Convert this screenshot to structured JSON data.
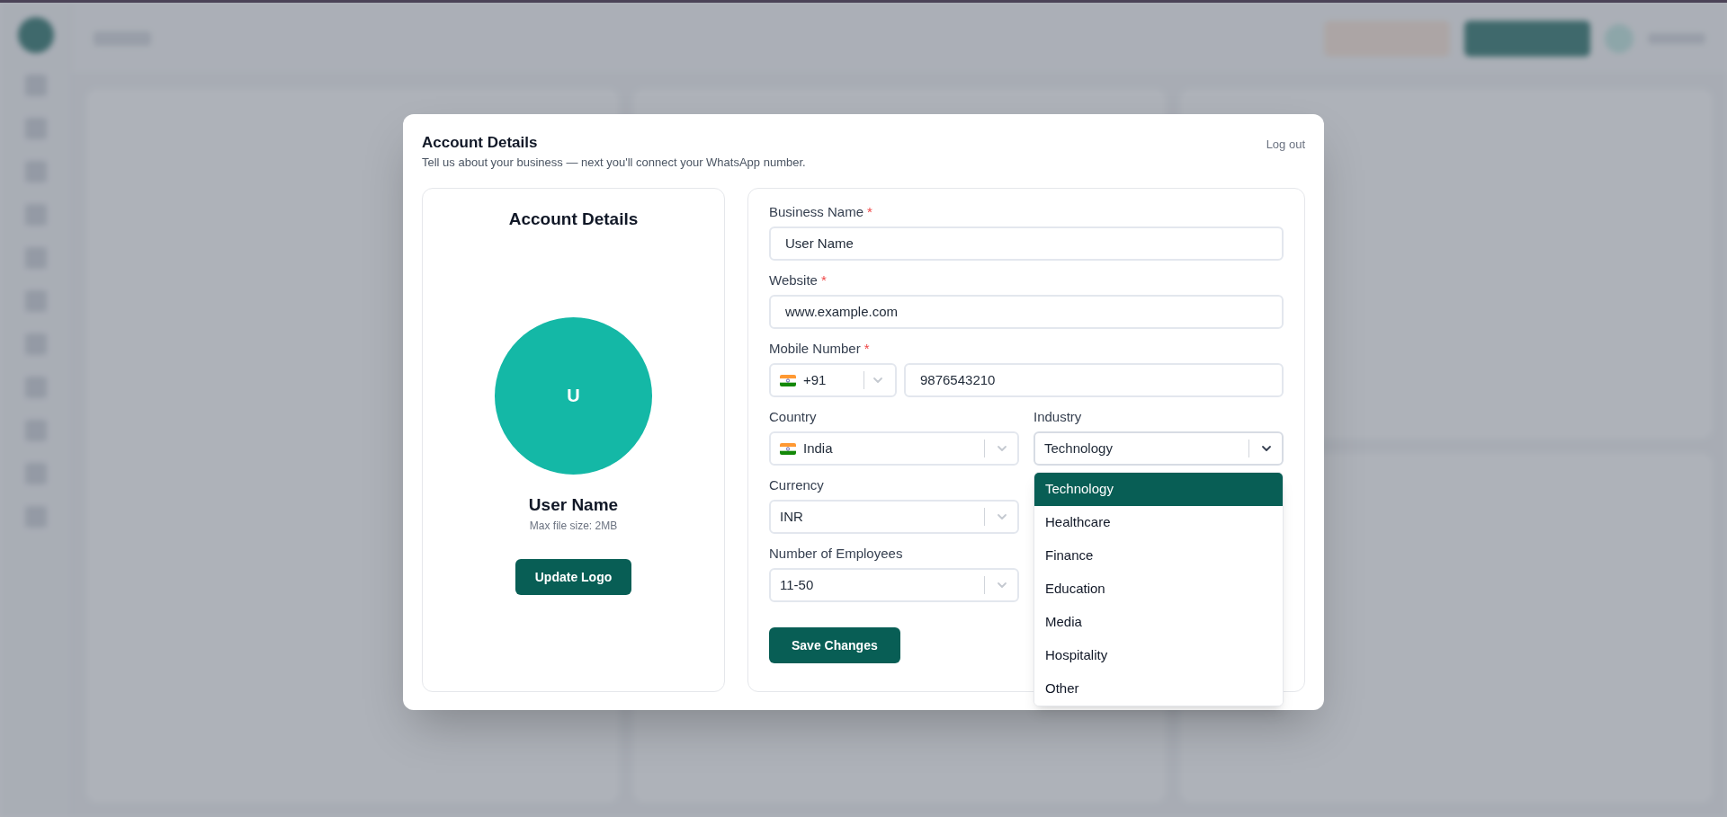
{
  "modal": {
    "title": "Account Details",
    "subtitle": "Tell us about your business — next you'll connect your WhatsApp number.",
    "logout": "Log out",
    "profile": {
      "title": "Account Details",
      "initial": "U",
      "name": "User Name",
      "hint": "Max file size: 2MB",
      "button": "Update Logo"
    },
    "field_groups": [
      {
        "fields": [
          {
            "kind": "text",
            "label": "Business Name",
            "mark": "*",
            "value": "User Name"
          }
        ]
      },
      {
        "fields": [
          {
            "kind": "text",
            "label": "Website",
            "mark": "*",
            "value": "www.example.com"
          }
        ]
      },
      {
        "fields": [
          {
            "kind": "phone",
            "label": "Mobile Number",
            "mark": "*",
            "code": "+91",
            "value": "9876543210"
          }
        ]
      },
      {
        "fields": [
          {
            "kind": "select",
            "label": "Country",
            "flag": true,
            "value": "India",
            "open": false
          },
          {
            "kind": "select",
            "label": "Industry",
            "flag": false,
            "value": "Technology",
            "open": true,
            "options": [
              {
                "label": "Technology",
                "selected": true
              },
              {
                "label": "Healthcare",
                "selected": false
              },
              {
                "label": "Finance",
                "selected": false
              },
              {
                "label": "Education",
                "selected": false
              },
              {
                "label": "Media",
                "selected": false
              },
              {
                "label": "Hospitality",
                "selected": false
              },
              {
                "label": "Other",
                "selected": false
              }
            ]
          }
        ]
      },
      {
        "fields": [
          {
            "kind": "select",
            "label": "Currency",
            "flag": false,
            "value": "INR",
            "open": false
          }
        ]
      },
      {
        "fields": [
          {
            "kind": "select",
            "label": "Number of Employees",
            "flag": false,
            "value": "11-50",
            "open": false
          }
        ]
      }
    ],
    "save": "Save Changes"
  }
}
